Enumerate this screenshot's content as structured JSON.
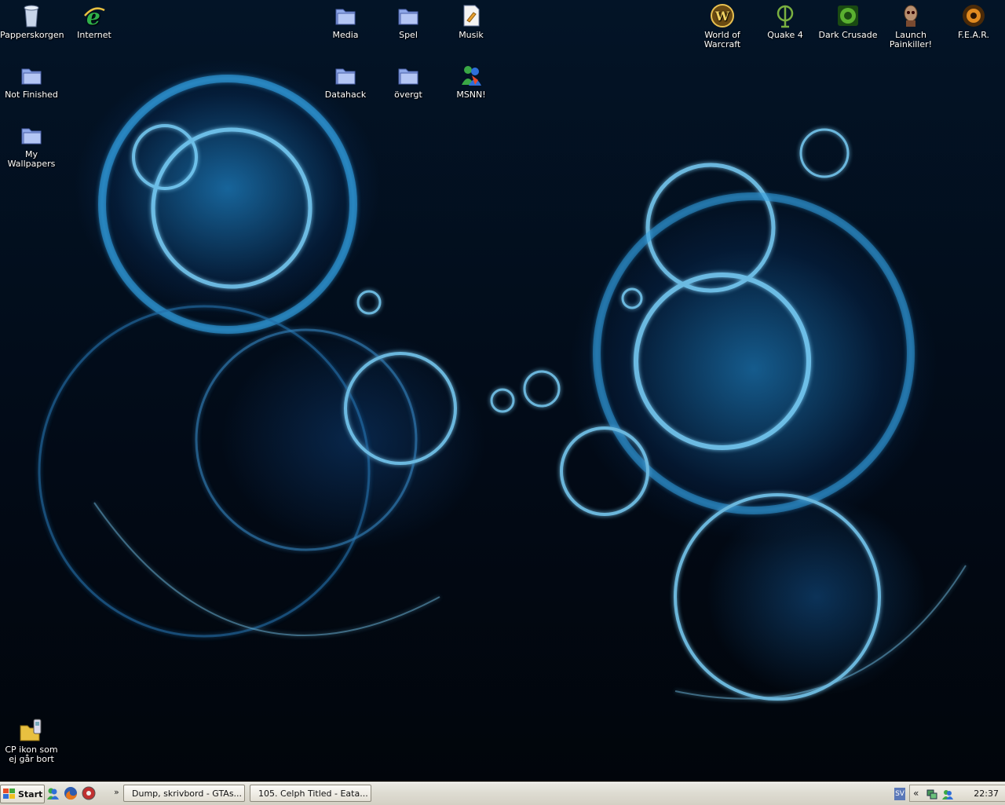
{
  "desktop": {
    "icons": [
      {
        "label": "Papperskorgen",
        "icon": "recycle-bin-icon"
      },
      {
        "label": "Internet",
        "icon": "internet-explorer-icon"
      },
      {
        "label": "Not Finished",
        "icon": "folder-icon"
      },
      {
        "label": "My Wallpapers",
        "icon": "folder-icon"
      },
      {
        "label": "Media",
        "icon": "folder-icon"
      },
      {
        "label": "Spel",
        "icon": "folder-icon"
      },
      {
        "label": "Musik",
        "icon": "music-file-icon"
      },
      {
        "label": "Datahack",
        "icon": "folder-icon"
      },
      {
        "label": "övergt",
        "icon": "folder-icon"
      },
      {
        "label": "MSNN!",
        "icon": "msn-messenger-icon"
      },
      {
        "label": "World of Warcraft",
        "icon": "world-of-warcraft-icon"
      },
      {
        "label": "Quake 4",
        "icon": "quake-4-icon"
      },
      {
        "label": "Dark Crusade",
        "icon": "dark-crusade-icon"
      },
      {
        "label": "Launch Painkiller!",
        "icon": "painkiller-icon"
      },
      {
        "label": "F.E.A.R.",
        "icon": "fear-icon"
      },
      {
        "label": "CP ikon som ej går bort",
        "icon": "phone-folder-icon"
      }
    ]
  },
  "taskbar": {
    "start_label": "Start",
    "quick_launch": [
      "msn-icon",
      "firefox-icon",
      "media-player-icon"
    ],
    "tasks": [
      {
        "label": "Dump, skrivbord - GTAs...",
        "icon": "firefox-icon"
      },
      {
        "label": "105. Celph Titled - Eata...",
        "icon": "winamp-icon"
      }
    ],
    "tray": {
      "language": "SV",
      "chevron": "«",
      "clock": "22:37"
    }
  },
  "colors": {
    "wallpaper_glow": "#28aaff",
    "taskbar": "#dedcd2",
    "folder": "#8fa8e8"
  }
}
